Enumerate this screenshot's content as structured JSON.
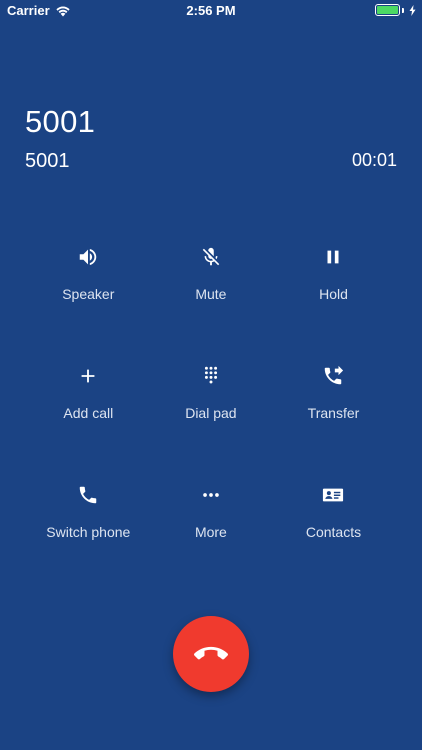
{
  "status_bar": {
    "carrier": "Carrier",
    "time": "2:56 PM",
    "battery_color": "#4cd964"
  },
  "call": {
    "name": "5001",
    "number": "5001",
    "duration": "00:01"
  },
  "actions": [
    {
      "label": "Speaker",
      "icon": "speaker-icon"
    },
    {
      "label": "Mute",
      "icon": "mic-off-icon"
    },
    {
      "label": "Hold",
      "icon": "pause-icon"
    },
    {
      "label": "Add call",
      "icon": "plus-icon"
    },
    {
      "label": "Dial pad",
      "icon": "dialpad-icon"
    },
    {
      "label": "Transfer",
      "icon": "phone-forward-icon"
    },
    {
      "label": "Switch phone",
      "icon": "phone-icon"
    },
    {
      "label": "More",
      "icon": "more-icon"
    },
    {
      "label": "Contacts",
      "icon": "contact-card-icon"
    }
  ],
  "colors": {
    "background": "#1b4384",
    "end_call": "#f03a2e"
  }
}
